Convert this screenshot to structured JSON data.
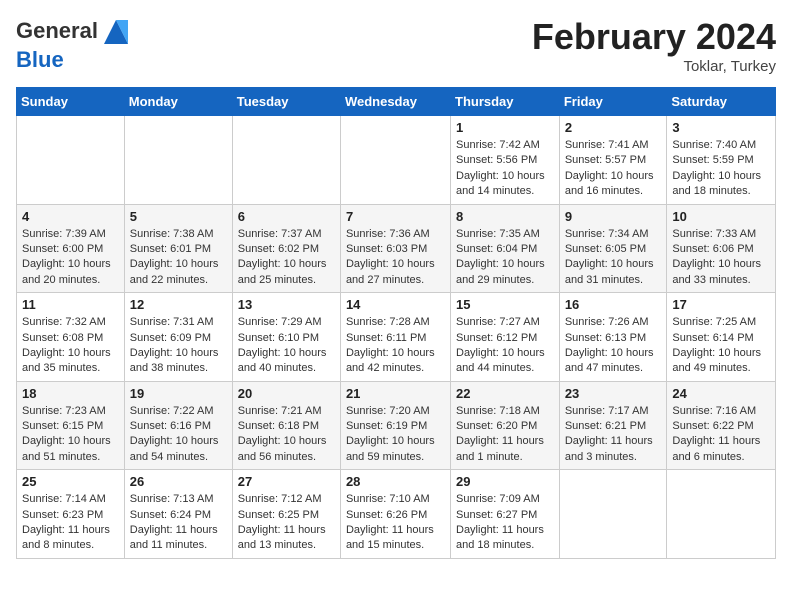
{
  "logo": {
    "line1": "General",
    "line2": "Blue"
  },
  "title": "February 2024",
  "location": "Toklar, Turkey",
  "days_of_week": [
    "Sunday",
    "Monday",
    "Tuesday",
    "Wednesday",
    "Thursday",
    "Friday",
    "Saturday"
  ],
  "weeks": [
    [
      {
        "day": "",
        "info": ""
      },
      {
        "day": "",
        "info": ""
      },
      {
        "day": "",
        "info": ""
      },
      {
        "day": "",
        "info": ""
      },
      {
        "day": "1",
        "info": "Sunrise: 7:42 AM\nSunset: 5:56 PM\nDaylight: 10 hours\nand 14 minutes."
      },
      {
        "day": "2",
        "info": "Sunrise: 7:41 AM\nSunset: 5:57 PM\nDaylight: 10 hours\nand 16 minutes."
      },
      {
        "day": "3",
        "info": "Sunrise: 7:40 AM\nSunset: 5:59 PM\nDaylight: 10 hours\nand 18 minutes."
      }
    ],
    [
      {
        "day": "4",
        "info": "Sunrise: 7:39 AM\nSunset: 6:00 PM\nDaylight: 10 hours\nand 20 minutes."
      },
      {
        "day": "5",
        "info": "Sunrise: 7:38 AM\nSunset: 6:01 PM\nDaylight: 10 hours\nand 22 minutes."
      },
      {
        "day": "6",
        "info": "Sunrise: 7:37 AM\nSunset: 6:02 PM\nDaylight: 10 hours\nand 25 minutes."
      },
      {
        "day": "7",
        "info": "Sunrise: 7:36 AM\nSunset: 6:03 PM\nDaylight: 10 hours\nand 27 minutes."
      },
      {
        "day": "8",
        "info": "Sunrise: 7:35 AM\nSunset: 6:04 PM\nDaylight: 10 hours\nand 29 minutes."
      },
      {
        "day": "9",
        "info": "Sunrise: 7:34 AM\nSunset: 6:05 PM\nDaylight: 10 hours\nand 31 minutes."
      },
      {
        "day": "10",
        "info": "Sunrise: 7:33 AM\nSunset: 6:06 PM\nDaylight: 10 hours\nand 33 minutes."
      }
    ],
    [
      {
        "day": "11",
        "info": "Sunrise: 7:32 AM\nSunset: 6:08 PM\nDaylight: 10 hours\nand 35 minutes."
      },
      {
        "day": "12",
        "info": "Sunrise: 7:31 AM\nSunset: 6:09 PM\nDaylight: 10 hours\nand 38 minutes."
      },
      {
        "day": "13",
        "info": "Sunrise: 7:29 AM\nSunset: 6:10 PM\nDaylight: 10 hours\nand 40 minutes."
      },
      {
        "day": "14",
        "info": "Sunrise: 7:28 AM\nSunset: 6:11 PM\nDaylight: 10 hours\nand 42 minutes."
      },
      {
        "day": "15",
        "info": "Sunrise: 7:27 AM\nSunset: 6:12 PM\nDaylight: 10 hours\nand 44 minutes."
      },
      {
        "day": "16",
        "info": "Sunrise: 7:26 AM\nSunset: 6:13 PM\nDaylight: 10 hours\nand 47 minutes."
      },
      {
        "day": "17",
        "info": "Sunrise: 7:25 AM\nSunset: 6:14 PM\nDaylight: 10 hours\nand 49 minutes."
      }
    ],
    [
      {
        "day": "18",
        "info": "Sunrise: 7:23 AM\nSunset: 6:15 PM\nDaylight: 10 hours\nand 51 minutes."
      },
      {
        "day": "19",
        "info": "Sunrise: 7:22 AM\nSunset: 6:16 PM\nDaylight: 10 hours\nand 54 minutes."
      },
      {
        "day": "20",
        "info": "Sunrise: 7:21 AM\nSunset: 6:18 PM\nDaylight: 10 hours\nand 56 minutes."
      },
      {
        "day": "21",
        "info": "Sunrise: 7:20 AM\nSunset: 6:19 PM\nDaylight: 10 hours\nand 59 minutes."
      },
      {
        "day": "22",
        "info": "Sunrise: 7:18 AM\nSunset: 6:20 PM\nDaylight: 11 hours\nand 1 minute."
      },
      {
        "day": "23",
        "info": "Sunrise: 7:17 AM\nSunset: 6:21 PM\nDaylight: 11 hours\nand 3 minutes."
      },
      {
        "day": "24",
        "info": "Sunrise: 7:16 AM\nSunset: 6:22 PM\nDaylight: 11 hours\nand 6 minutes."
      }
    ],
    [
      {
        "day": "25",
        "info": "Sunrise: 7:14 AM\nSunset: 6:23 PM\nDaylight: 11 hours\nand 8 minutes."
      },
      {
        "day": "26",
        "info": "Sunrise: 7:13 AM\nSunset: 6:24 PM\nDaylight: 11 hours\nand 11 minutes."
      },
      {
        "day": "27",
        "info": "Sunrise: 7:12 AM\nSunset: 6:25 PM\nDaylight: 11 hours\nand 13 minutes."
      },
      {
        "day": "28",
        "info": "Sunrise: 7:10 AM\nSunset: 6:26 PM\nDaylight: 11 hours\nand 15 minutes."
      },
      {
        "day": "29",
        "info": "Sunrise: 7:09 AM\nSunset: 6:27 PM\nDaylight: 11 hours\nand 18 minutes."
      },
      {
        "day": "",
        "info": ""
      },
      {
        "day": "",
        "info": ""
      }
    ]
  ]
}
